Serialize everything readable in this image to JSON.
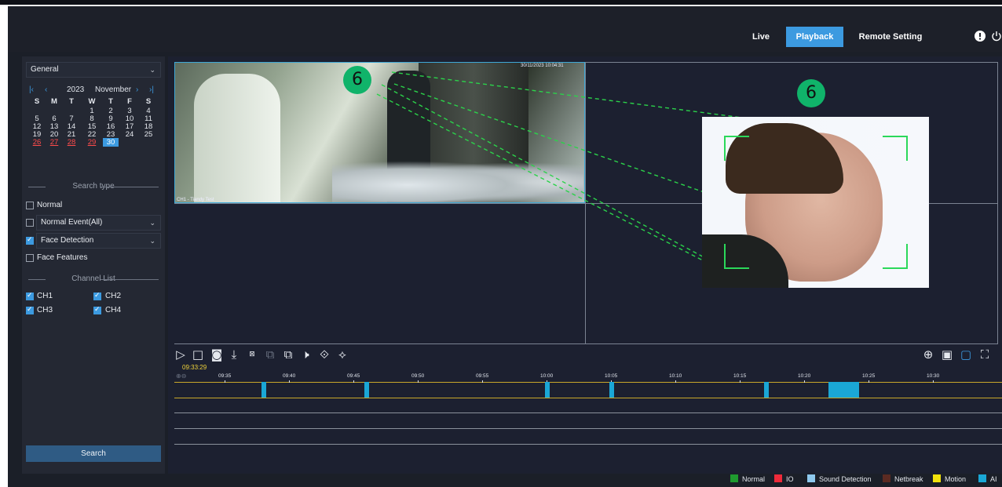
{
  "header": {
    "nav": [
      {
        "label": "Live",
        "active": false
      },
      {
        "label": "Playback",
        "active": true
      },
      {
        "label": "Remote Setting",
        "active": false
      }
    ],
    "icons": [
      "info-icon",
      "power-icon"
    ],
    "accent_color": "#3c9ae0"
  },
  "sidebar": {
    "mode_select": "General",
    "calendar": {
      "year": "2023",
      "month": "November",
      "weekdays": [
        "S",
        "M",
        "T",
        "W",
        "T",
        "F",
        "S"
      ],
      "weeks": [
        [
          "",
          "",
          "",
          "1",
          "2",
          "3",
          "4"
        ],
        [
          "5",
          "6",
          "7",
          "8",
          "9",
          "10",
          "11"
        ],
        [
          "12",
          "13",
          "14",
          "15",
          "16",
          "17",
          "18"
        ],
        [
          "19",
          "20",
          "21",
          "22",
          "23",
          "24",
          "25"
        ],
        [
          "26",
          "27",
          "28",
          "29",
          "30",
          "",
          ""
        ]
      ],
      "recorded_days": [
        "26",
        "27",
        "28",
        "29"
      ],
      "selected_day": "30"
    },
    "search_type_title": "Search type",
    "search_types": [
      {
        "label": "Normal",
        "checked": false,
        "dropdown": false
      },
      {
        "label": "Normal Event(All)",
        "checked": false,
        "dropdown": true
      },
      {
        "label": "Face Detection",
        "checked": true,
        "dropdown": true
      },
      {
        "label": "Face Features",
        "checked": false,
        "dropdown": false
      }
    ],
    "channel_list_title": "Channel List",
    "channels": [
      {
        "label": "CH1",
        "checked": true
      },
      {
        "label": "CH2",
        "checked": true
      },
      {
        "label": "CH3",
        "checked": true
      },
      {
        "label": "CH4",
        "checked": true
      }
    ],
    "search_button": "Search"
  },
  "video": {
    "osd_time": "30/11/2023 10:04:31",
    "osd_name": "CH1 - Tiandy Test",
    "annotation_number": "6"
  },
  "toolbar": {
    "left_icons": [
      "play-icon",
      "stop-icon",
      "snapshot-icon",
      "download-icon",
      "speed-x1-icon",
      "clip-start-icon",
      "clip-end-icon",
      "mute-icon",
      "tag-icon",
      "manage-tags-icon"
    ],
    "right_icons": [
      "zoom-in-icon",
      "single-view-icon",
      "quad-view-icon",
      "fullscreen-icon"
    ]
  },
  "timeline": {
    "current_time": "09:33:29",
    "ticks": [
      "09:35",
      "09:40",
      "09:45",
      "09:50",
      "09:55",
      "10:00",
      "10:05",
      "10:10",
      "10:15",
      "10:20",
      "10:25",
      "10:30"
    ],
    "events": [
      {
        "start": "09:38",
        "end": "09:38"
      },
      {
        "start": "09:46",
        "end": "09:46"
      },
      {
        "start": "10:00",
        "end": "10:00"
      },
      {
        "start": "10:05",
        "end": "10:05"
      },
      {
        "start": "10:17",
        "end": "10:17"
      },
      {
        "start": "10:22",
        "end": "10:24"
      }
    ]
  },
  "legend": [
    {
      "label": "Normal",
      "color": "#1f9a2f"
    },
    {
      "label": "IO",
      "color": "#ee2a3a"
    },
    {
      "label": "Sound Detection",
      "color": "#8ec9ee"
    },
    {
      "label": "Netbreak",
      "color": "#5b2a22"
    },
    {
      "label": "Motion",
      "color": "#f2e20c"
    },
    {
      "label": "AI",
      "color": "#1aa7d6"
    }
  ]
}
